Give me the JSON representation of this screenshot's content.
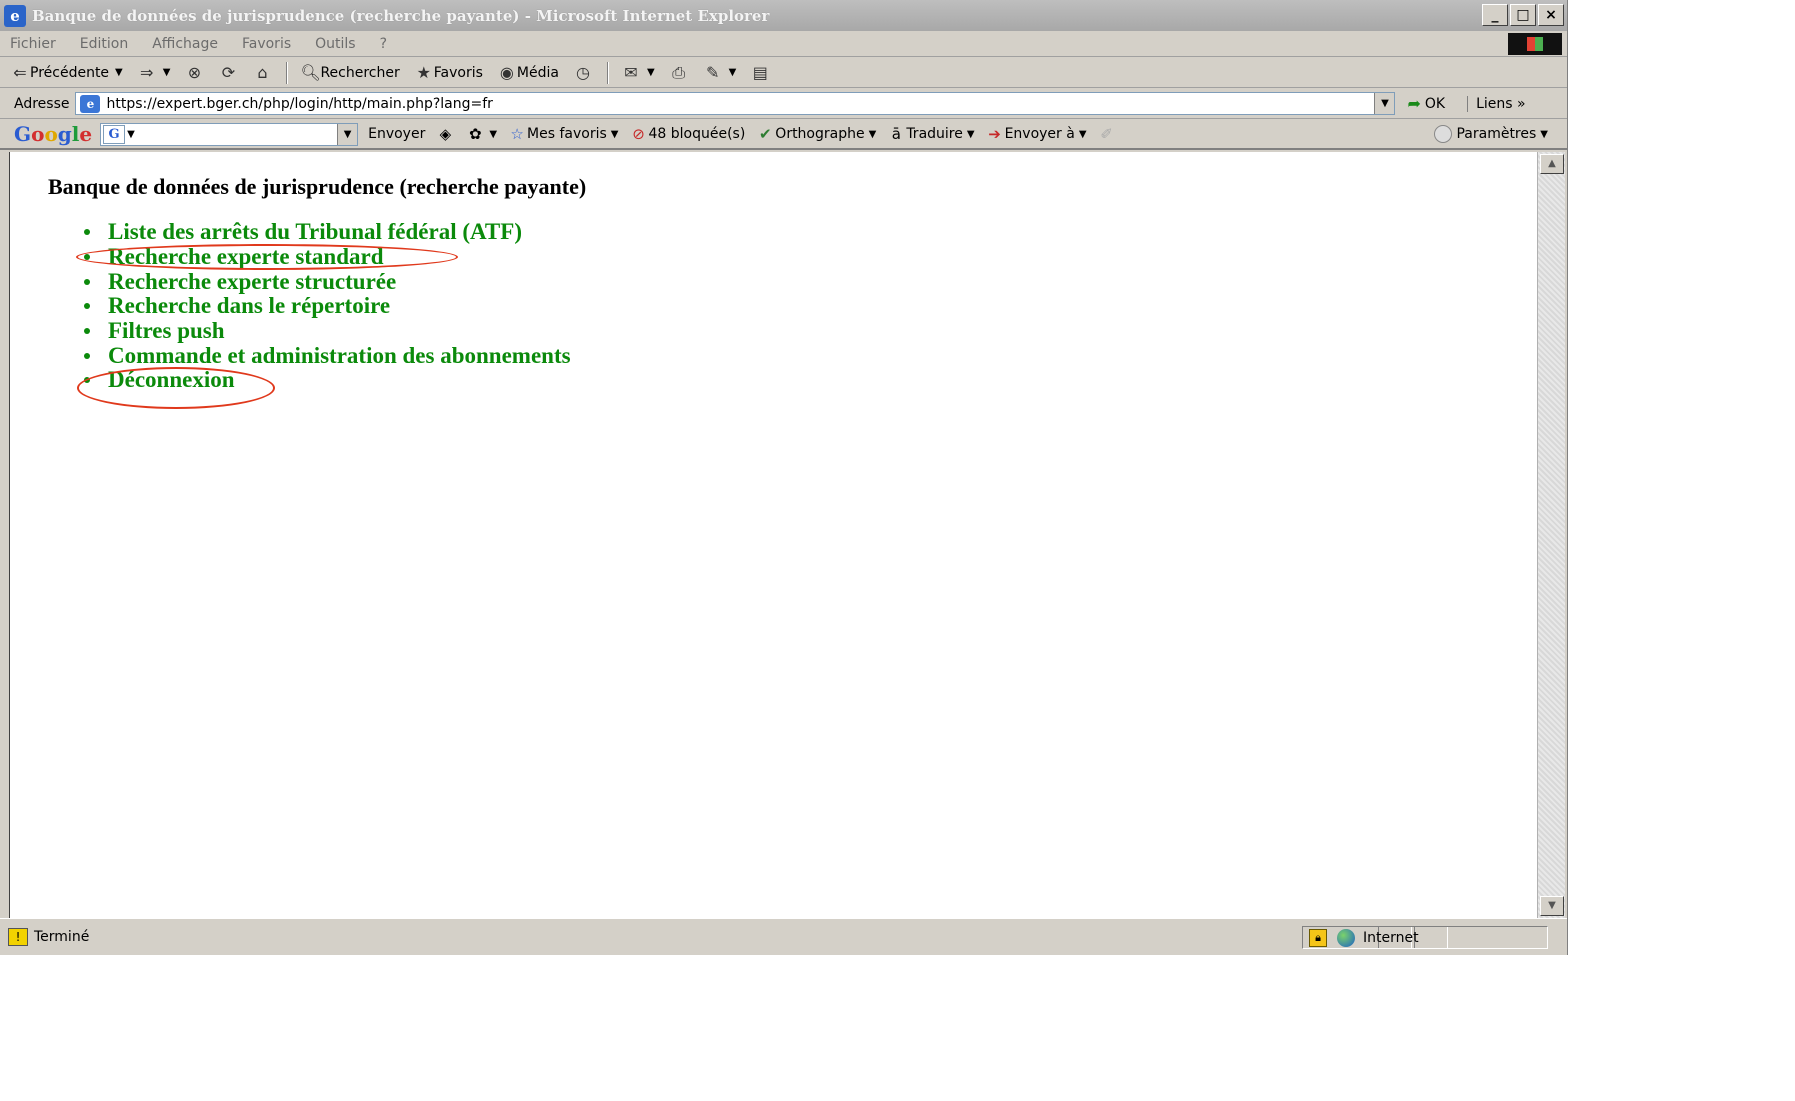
{
  "window": {
    "title": "Banque de données de jurisprudence (recherche payante) - Microsoft Internet Explorer",
    "controls": {
      "minimize": "_",
      "maximize": "□",
      "close": "×"
    }
  },
  "menubar": {
    "items": [
      "Fichier",
      "Edition",
      "Affichage",
      "Favoris",
      "Outils",
      "?"
    ]
  },
  "toolbar": {
    "back_label": "Précédente",
    "search_label": "Rechercher",
    "favorites_label": "Favoris",
    "media_label": "Média"
  },
  "address": {
    "label": "Adresse",
    "url": "https://expert.bger.ch/php/login/http/main.php?lang=fr",
    "go_label": "OK",
    "links_label": "Liens"
  },
  "google_bar": {
    "logo": "Google",
    "send_label": "Envoyer",
    "bookmarks_label": "Mes favoris",
    "popups_label": "48 bloquée(s)",
    "spell_label": "Orthographe",
    "translate_label": "Traduire",
    "sendto_label": "Envoyer à",
    "settings_label": "Paramètres"
  },
  "page": {
    "heading": "Banque de données de jurisprudence (recherche payante)",
    "links": [
      "Liste des arrêts du Tribunal fédéral (ATF)",
      "Recherche experte standard",
      "Recherche experte structurée",
      "Recherche dans le répertoire",
      "Filtres push",
      "Commande et administration des abonnements",
      "Déconnexion"
    ]
  },
  "status": {
    "text": "Terminé",
    "zone": "Internet"
  },
  "colors": {
    "link": "#0b8a0b",
    "annotation": "#e0391c",
    "chrome": "#d4d0c8"
  }
}
